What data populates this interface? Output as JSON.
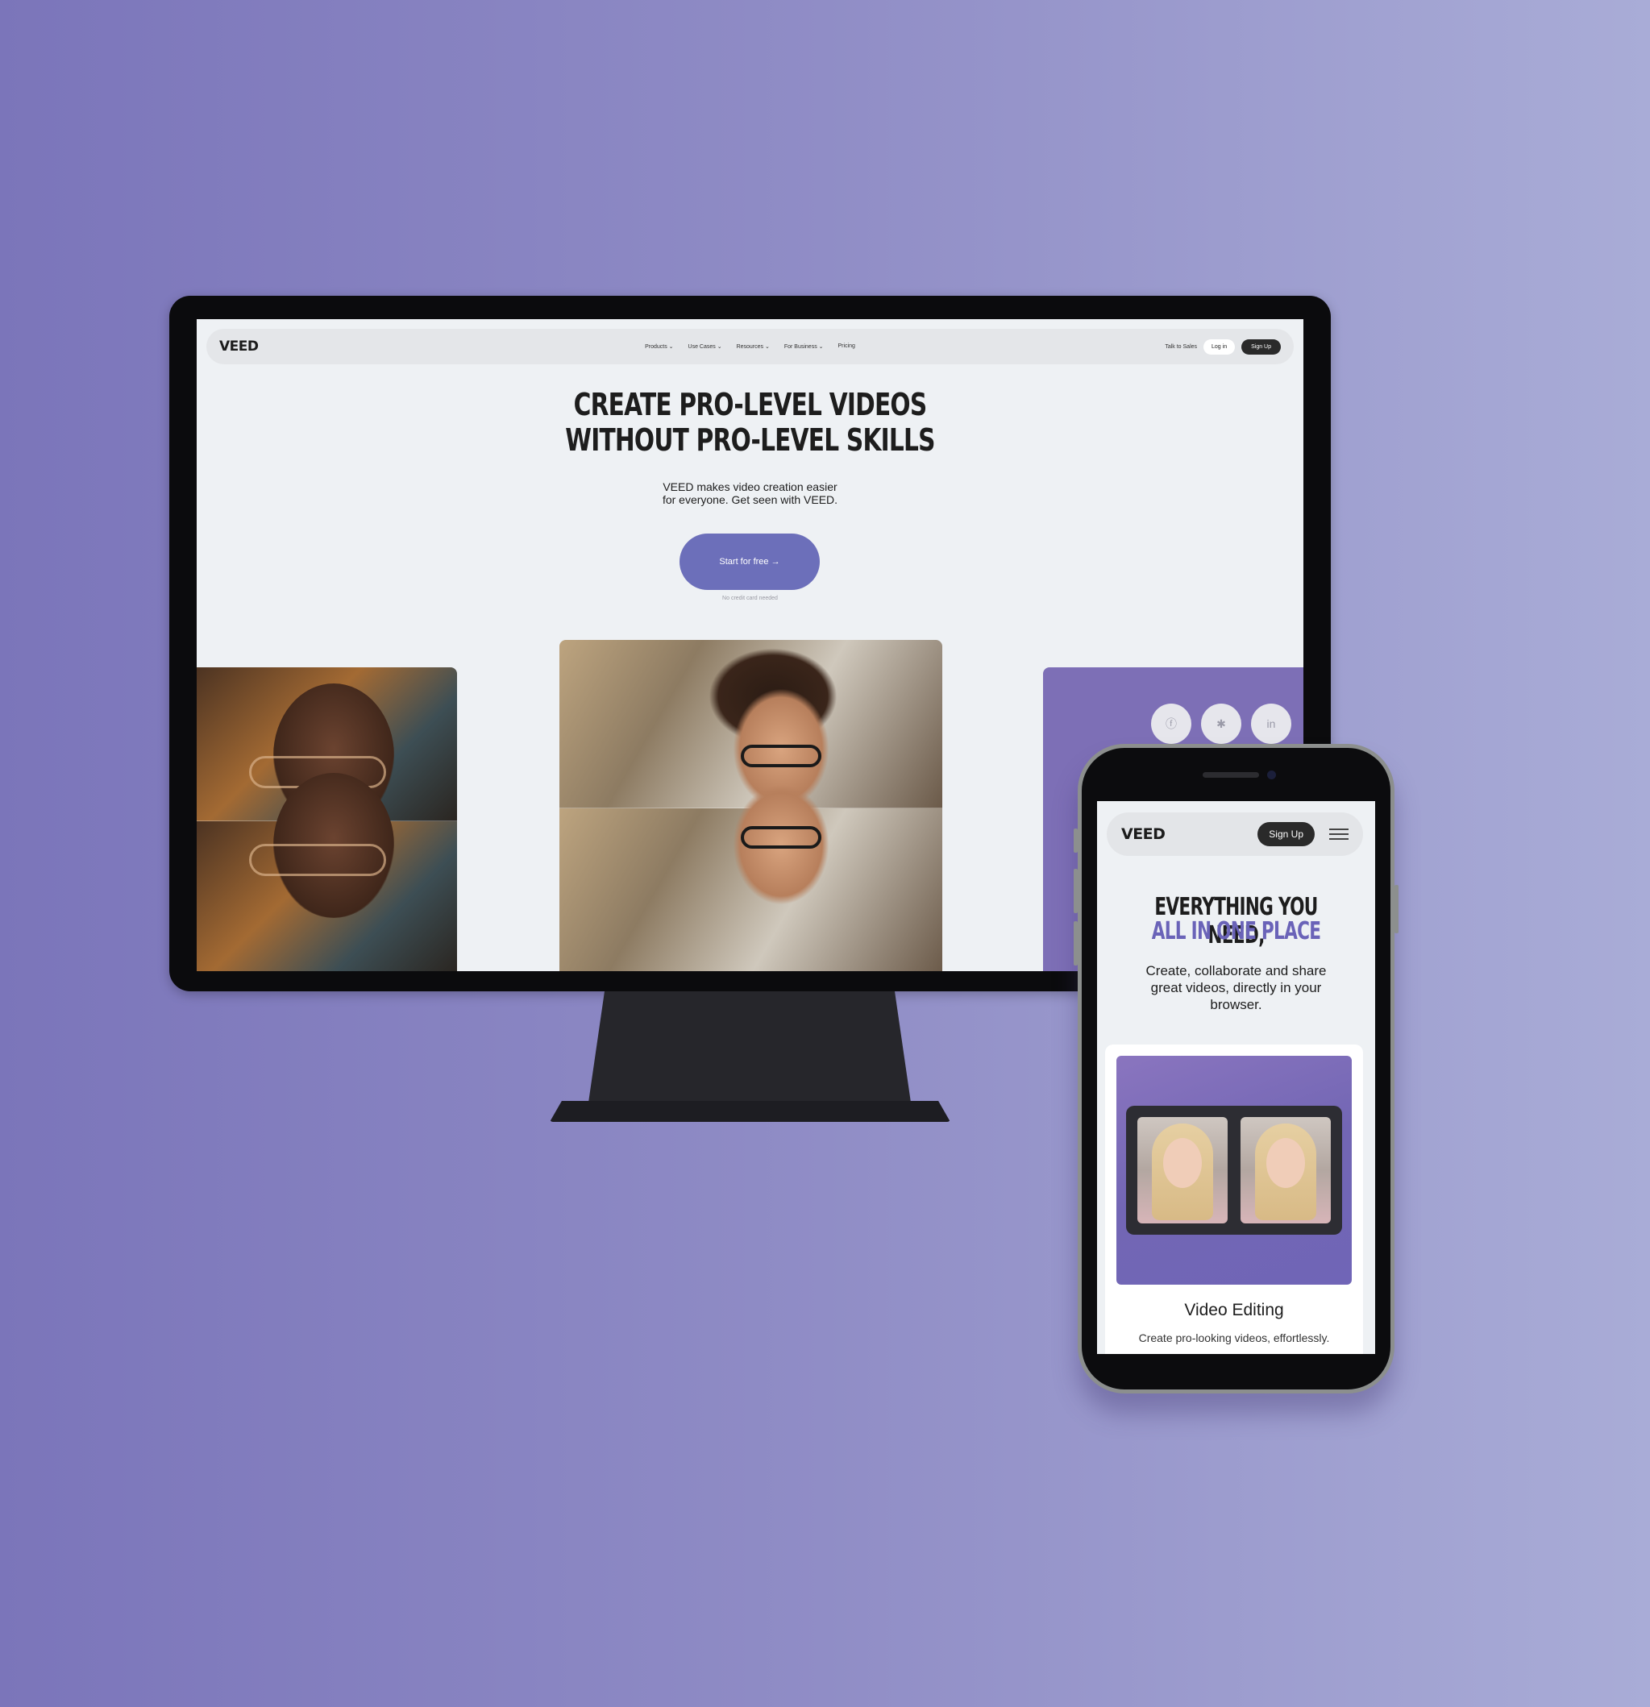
{
  "desktop": {
    "nav": {
      "logo": "VEED",
      "menu": [
        "Products ⌄",
        "Use Cases ⌄",
        "Resources ⌄",
        "For Business ⌄",
        "Pricing"
      ],
      "talk_to_sales": "Talk to Sales",
      "login": "Log in",
      "signup": "Sign Up"
    },
    "hero": {
      "headline_line1": "CREATE PRO-LEVEL VIDEOS",
      "headline_line2": "WITHOUT PRO-LEVEL SKILLS",
      "subtitle_line1": "VEED makes video creation easier",
      "subtitle_line2": "for everyone. Get seen with VEED.",
      "cta": "Start for free →",
      "cta_note": "No credit card needed"
    },
    "social_icons": [
      "facebook-icon",
      "slack-icon",
      "linkedin-icon"
    ]
  },
  "phone": {
    "nav": {
      "logo": "VEED",
      "signup": "Sign Up"
    },
    "headline_line1": "EVERYTHING YOU NEED,",
    "headline_line2": "ALL IN ONE PLACE",
    "subtitle": "Create, collaborate and share great videos, directly in your browser.",
    "card": {
      "title": "Video Editing",
      "description": "Create pro-looking videos, effortlessly."
    }
  },
  "colors": {
    "accent": "#6c6fba",
    "headline_accent": "#6a63b8",
    "background_left": "#7b75ba",
    "background_right": "#a9acd7"
  }
}
